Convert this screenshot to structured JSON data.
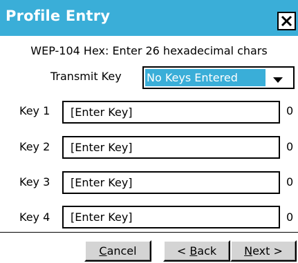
{
  "window": {
    "title": "Profile Entry",
    "close_glyph": "X"
  },
  "info_text": "WEP-104 Hex: Enter 26 hexadecimal chars",
  "transmit_key": {
    "label": "Transmit Key",
    "selected_value": "No Keys Entered"
  },
  "keys": [
    {
      "label": "Key 1",
      "value": "[Enter Key]",
      "count": "0"
    },
    {
      "label": "Key 2",
      "value": "[Enter Key]",
      "count": "0"
    },
    {
      "label": "Key 3",
      "value": "[Enter Key]",
      "count": "0"
    },
    {
      "label": "Key 4",
      "value": "[Enter Key]",
      "count": "0"
    }
  ],
  "buttons": {
    "cancel": {
      "mnemonic": "C",
      "rest": "ancel"
    },
    "back": {
      "prefix": "< ",
      "mnemonic": "B",
      "rest": "ack"
    },
    "next": {
      "mnemonic": "N",
      "rest": "ext >"
    }
  },
  "colors": {
    "titlebar": "#3aaed8",
    "selection": "#3aaed8",
    "button_face": "#d4d4d4"
  },
  "icons": {
    "close": "close-icon",
    "dropdown": "chevron-down-icon"
  }
}
